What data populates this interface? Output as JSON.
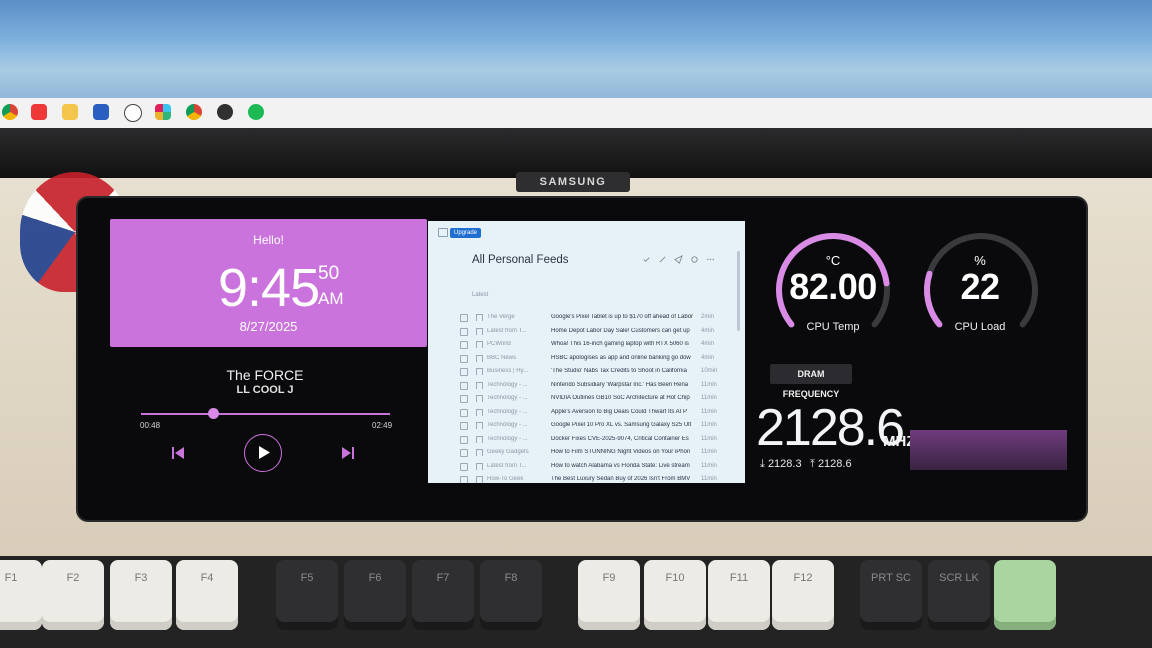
{
  "taskbar": {
    "icons": [
      "chrome-icon",
      "vivaldi-icon",
      "file-explorer-icon",
      "word-icon",
      "dell-icon",
      "slack-icon",
      "chrome-icon",
      "obs-icon",
      "spotify-icon"
    ]
  },
  "monitor": {
    "brand": "SAMSUNG"
  },
  "music": {
    "greeting": "Hello!",
    "time": "9:45",
    "seconds": "50",
    "ampm": "AM",
    "date": "8/27/2025",
    "track_title": "The FORCE",
    "track_artist": "LL COOL J",
    "elapsed": "00:48",
    "total": "02:49",
    "progress": 0.29,
    "accent": "#cb73dc"
  },
  "feed": {
    "upgrade_label": "Upgrade",
    "title": "All Personal Feeds",
    "section": "Latest",
    "rows": [
      {
        "source": "The Verge",
        "headline": "Google's Pixel Tablet is up to $170 off ahead of Labor",
        "age": "2min"
      },
      {
        "source": "Latest from T...",
        "headline": "Home Depot Labor Day Sale! Customers can get up",
        "age": "4min"
      },
      {
        "source": "PCWorld",
        "headline": "Whoa! This 16-inch gaming laptop with RTX 5060 is",
        "age": "4min"
      },
      {
        "source": "BBC News",
        "headline": "HSBC apologises as app and online banking go dow",
        "age": "4min"
      },
      {
        "source": "Business | Hy...",
        "headline": "'The Studio' Nabs Tax Credits to Shoot in California",
        "age": "10min"
      },
      {
        "source": "Technology - ...",
        "headline": "Nintendo Subsidiary 'Warpstar Inc.' Has Been Rena",
        "age": "11min"
      },
      {
        "source": "Technology - ...",
        "headline": "NVIDIA Outlines GB10 SoC Architecture at Hot Chip",
        "age": "11min"
      },
      {
        "source": "Technology - ...",
        "headline": "Apple's Aversion to Big Deals Could Thwart Its AI P",
        "age": "11min"
      },
      {
        "source": "Technology - ...",
        "headline": "Google Pixel 10 Pro XL vs. Samsung Galaxy S25 Ult",
        "age": "11min"
      },
      {
        "source": "Technology - ...",
        "headline": "Docker Fixes CVE-2025-9074, Critical Container Es",
        "age": "11min"
      },
      {
        "source": "Geeky Gadgets",
        "headline": "How to Film STUNNING Night Videos on Your iPhon",
        "age": "11min"
      },
      {
        "source": "Latest from T...",
        "headline": "How to watch Alabama vs Florida State: Live stream",
        "age": "11min"
      },
      {
        "source": "How-To Geek",
        "headline": "The Best Luxury Sedan Buy of 2026 Isn't From BMV",
        "age": "11min"
      }
    ]
  },
  "cpu_temp": {
    "unit": "°C",
    "value": "82.00",
    "label": "CPU Temp",
    "fraction": 0.82
  },
  "cpu_load": {
    "unit": "%",
    "value": "22",
    "label": "CPU Load",
    "fraction": 0.22
  },
  "dram": {
    "badge": "DRAM FREQUENCY",
    "value": "2128.6",
    "unit": "MHZ",
    "min": "2128.3",
    "max": "2128.6"
  },
  "keyboard": {
    "keys": [
      "F1",
      "F2",
      "F3",
      "F4",
      "F5",
      "F6",
      "F7",
      "F8",
      "F9",
      "F10",
      "F11",
      "F12",
      "PRT SC",
      "SCR LK",
      ""
    ]
  }
}
